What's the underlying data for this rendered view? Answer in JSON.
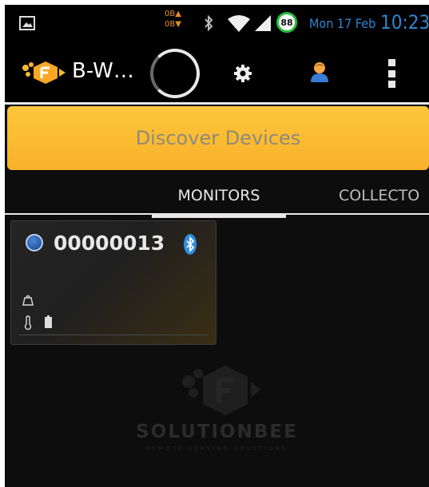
{
  "status_bar": {
    "data_up": "0B▲",
    "data_down": "0B▼",
    "battery_level": "88",
    "date": "Mon 17 Feb",
    "time": "10:23",
    "icons": [
      "image-notification-icon",
      "bluetooth-icon",
      "wifi-icon",
      "cell-signal-icon",
      "battery-icon"
    ]
  },
  "action_bar": {
    "title": "B-W…",
    "icons": [
      "app-logo",
      "loading-spinner",
      "gear-icon",
      "user-icon",
      "overflow-menu-icon"
    ]
  },
  "discover_button": {
    "label": "Discover Devices"
  },
  "tabs": [
    {
      "label": "MONITORS",
      "selected": true
    },
    {
      "label": "COLLECTO",
      "selected": false
    }
  ],
  "devices": [
    {
      "id": "00000013",
      "status_color": "#3a6fc0",
      "icons": [
        "bluetooth-icon",
        "weight-icon",
        "thermometer-icon",
        "battery-icon"
      ]
    }
  ],
  "colors": {
    "accent_blue": "#2d86d0",
    "discover_yellow": "#f9b92f",
    "battery_ring": "#25c13a",
    "data_orange": "#e48a2f"
  }
}
